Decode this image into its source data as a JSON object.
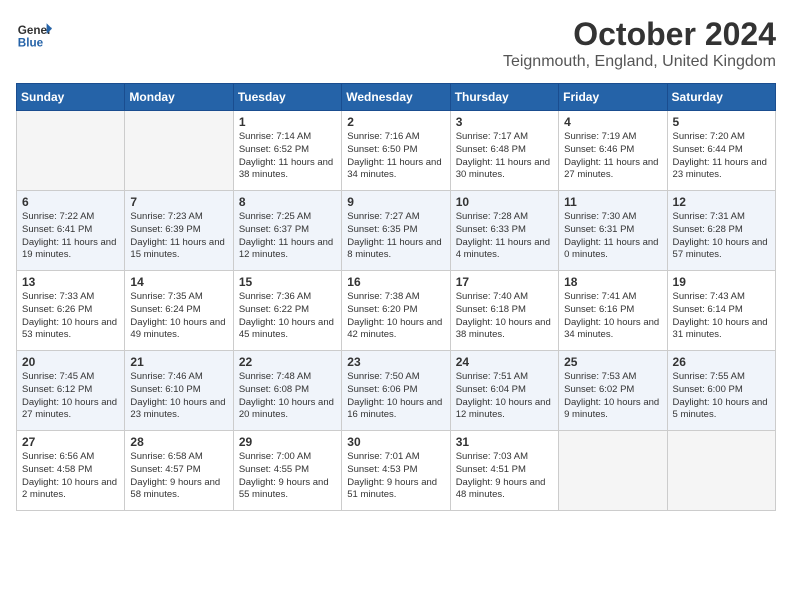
{
  "header": {
    "logo_general": "General",
    "logo_blue": "Blue",
    "month": "October 2024",
    "location": "Teignmouth, England, United Kingdom"
  },
  "days_of_week": [
    "Sunday",
    "Monday",
    "Tuesday",
    "Wednesday",
    "Thursday",
    "Friday",
    "Saturday"
  ],
  "weeks": [
    [
      {
        "day": "",
        "empty": true
      },
      {
        "day": "",
        "empty": true
      },
      {
        "day": "1",
        "sunrise": "Sunrise: 7:14 AM",
        "sunset": "Sunset: 6:52 PM",
        "daylight": "Daylight: 11 hours and 38 minutes."
      },
      {
        "day": "2",
        "sunrise": "Sunrise: 7:16 AM",
        "sunset": "Sunset: 6:50 PM",
        "daylight": "Daylight: 11 hours and 34 minutes."
      },
      {
        "day": "3",
        "sunrise": "Sunrise: 7:17 AM",
        "sunset": "Sunset: 6:48 PM",
        "daylight": "Daylight: 11 hours and 30 minutes."
      },
      {
        "day": "4",
        "sunrise": "Sunrise: 7:19 AM",
        "sunset": "Sunset: 6:46 PM",
        "daylight": "Daylight: 11 hours and 27 minutes."
      },
      {
        "day": "5",
        "sunrise": "Sunrise: 7:20 AM",
        "sunset": "Sunset: 6:44 PM",
        "daylight": "Daylight: 11 hours and 23 minutes."
      }
    ],
    [
      {
        "day": "6",
        "sunrise": "Sunrise: 7:22 AM",
        "sunset": "Sunset: 6:41 PM",
        "daylight": "Daylight: 11 hours and 19 minutes."
      },
      {
        "day": "7",
        "sunrise": "Sunrise: 7:23 AM",
        "sunset": "Sunset: 6:39 PM",
        "daylight": "Daylight: 11 hours and 15 minutes."
      },
      {
        "day": "8",
        "sunrise": "Sunrise: 7:25 AM",
        "sunset": "Sunset: 6:37 PM",
        "daylight": "Daylight: 11 hours and 12 minutes."
      },
      {
        "day": "9",
        "sunrise": "Sunrise: 7:27 AM",
        "sunset": "Sunset: 6:35 PM",
        "daylight": "Daylight: 11 hours and 8 minutes."
      },
      {
        "day": "10",
        "sunrise": "Sunrise: 7:28 AM",
        "sunset": "Sunset: 6:33 PM",
        "daylight": "Daylight: 11 hours and 4 minutes."
      },
      {
        "day": "11",
        "sunrise": "Sunrise: 7:30 AM",
        "sunset": "Sunset: 6:31 PM",
        "daylight": "Daylight: 11 hours and 0 minutes."
      },
      {
        "day": "12",
        "sunrise": "Sunrise: 7:31 AM",
        "sunset": "Sunset: 6:28 PM",
        "daylight": "Daylight: 10 hours and 57 minutes."
      }
    ],
    [
      {
        "day": "13",
        "sunrise": "Sunrise: 7:33 AM",
        "sunset": "Sunset: 6:26 PM",
        "daylight": "Daylight: 10 hours and 53 minutes."
      },
      {
        "day": "14",
        "sunrise": "Sunrise: 7:35 AM",
        "sunset": "Sunset: 6:24 PM",
        "daylight": "Daylight: 10 hours and 49 minutes."
      },
      {
        "day": "15",
        "sunrise": "Sunrise: 7:36 AM",
        "sunset": "Sunset: 6:22 PM",
        "daylight": "Daylight: 10 hours and 45 minutes."
      },
      {
        "day": "16",
        "sunrise": "Sunrise: 7:38 AM",
        "sunset": "Sunset: 6:20 PM",
        "daylight": "Daylight: 10 hours and 42 minutes."
      },
      {
        "day": "17",
        "sunrise": "Sunrise: 7:40 AM",
        "sunset": "Sunset: 6:18 PM",
        "daylight": "Daylight: 10 hours and 38 minutes."
      },
      {
        "day": "18",
        "sunrise": "Sunrise: 7:41 AM",
        "sunset": "Sunset: 6:16 PM",
        "daylight": "Daylight: 10 hours and 34 minutes."
      },
      {
        "day": "19",
        "sunrise": "Sunrise: 7:43 AM",
        "sunset": "Sunset: 6:14 PM",
        "daylight": "Daylight: 10 hours and 31 minutes."
      }
    ],
    [
      {
        "day": "20",
        "sunrise": "Sunrise: 7:45 AM",
        "sunset": "Sunset: 6:12 PM",
        "daylight": "Daylight: 10 hours and 27 minutes."
      },
      {
        "day": "21",
        "sunrise": "Sunrise: 7:46 AM",
        "sunset": "Sunset: 6:10 PM",
        "daylight": "Daylight: 10 hours and 23 minutes."
      },
      {
        "day": "22",
        "sunrise": "Sunrise: 7:48 AM",
        "sunset": "Sunset: 6:08 PM",
        "daylight": "Daylight: 10 hours and 20 minutes."
      },
      {
        "day": "23",
        "sunrise": "Sunrise: 7:50 AM",
        "sunset": "Sunset: 6:06 PM",
        "daylight": "Daylight: 10 hours and 16 minutes."
      },
      {
        "day": "24",
        "sunrise": "Sunrise: 7:51 AM",
        "sunset": "Sunset: 6:04 PM",
        "daylight": "Daylight: 10 hours and 12 minutes."
      },
      {
        "day": "25",
        "sunrise": "Sunrise: 7:53 AM",
        "sunset": "Sunset: 6:02 PM",
        "daylight": "Daylight: 10 hours and 9 minutes."
      },
      {
        "day": "26",
        "sunrise": "Sunrise: 7:55 AM",
        "sunset": "Sunset: 6:00 PM",
        "daylight": "Daylight: 10 hours and 5 minutes."
      }
    ],
    [
      {
        "day": "27",
        "sunrise": "Sunrise: 6:56 AM",
        "sunset": "Sunset: 4:58 PM",
        "daylight": "Daylight: 10 hours and 2 minutes."
      },
      {
        "day": "28",
        "sunrise": "Sunrise: 6:58 AM",
        "sunset": "Sunset: 4:57 PM",
        "daylight": "Daylight: 9 hours and 58 minutes."
      },
      {
        "day": "29",
        "sunrise": "Sunrise: 7:00 AM",
        "sunset": "Sunset: 4:55 PM",
        "daylight": "Daylight: 9 hours and 55 minutes."
      },
      {
        "day": "30",
        "sunrise": "Sunrise: 7:01 AM",
        "sunset": "Sunset: 4:53 PM",
        "daylight": "Daylight: 9 hours and 51 minutes."
      },
      {
        "day": "31",
        "sunrise": "Sunrise: 7:03 AM",
        "sunset": "Sunset: 4:51 PM",
        "daylight": "Daylight: 9 hours and 48 minutes."
      },
      {
        "day": "",
        "empty": true
      },
      {
        "day": "",
        "empty": true
      }
    ]
  ]
}
